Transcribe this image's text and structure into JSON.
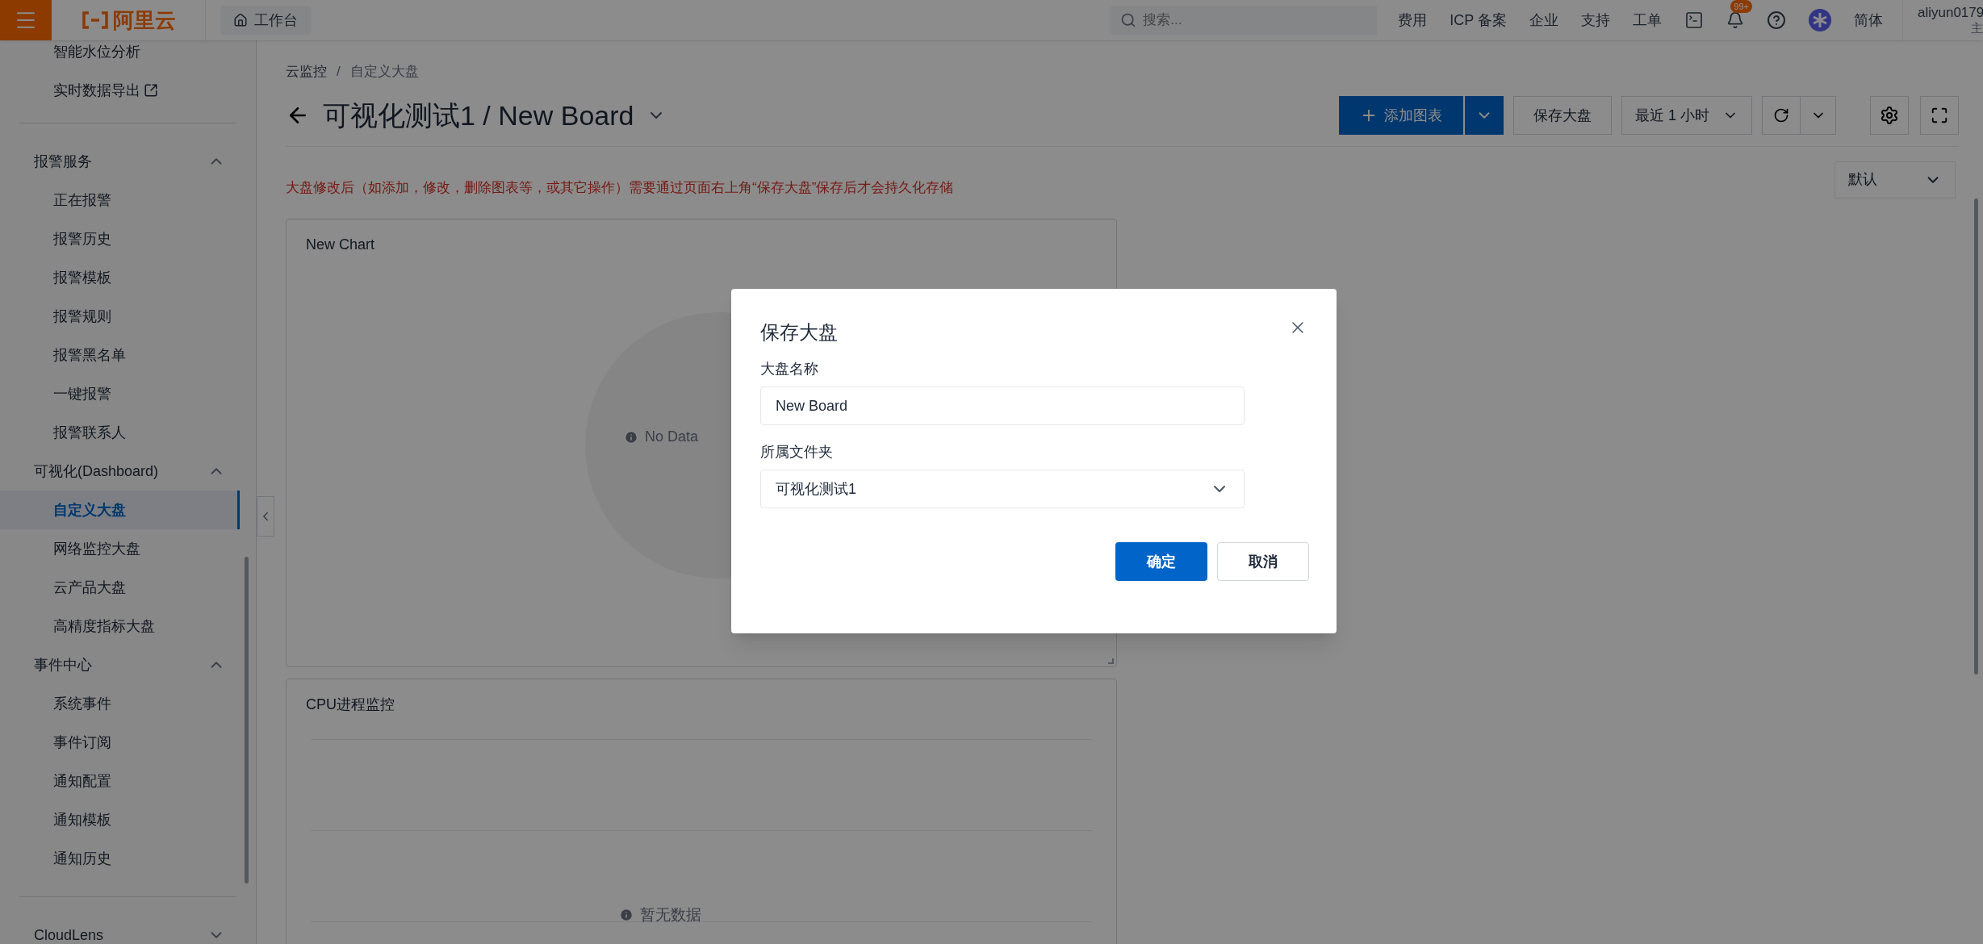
{
  "top_bar": {
    "logo": "阿里云",
    "home_tab": "工作台",
    "search": {
      "placeholder": "搜索..."
    },
    "links": [
      "费用",
      "ICP 备案",
      "企业",
      "支持",
      "工单"
    ],
    "notification_badge": "99+",
    "language": "简体",
    "user": {
      "name": "aliyun0179",
      "role": "主"
    }
  },
  "sidebar": {
    "top_items": [
      {
        "label": "智能水位分析",
        "external": false
      },
      {
        "label": "实时数据导出",
        "external": true
      }
    ],
    "groups": [
      {
        "label": "报警服务",
        "expanded": true,
        "children": [
          {
            "label": "正在报警",
            "selected": false
          },
          {
            "label": "报警历史",
            "selected": false
          },
          {
            "label": "报警模板",
            "selected": false
          },
          {
            "label": "报警规则",
            "selected": false
          },
          {
            "label": "报警黑名单",
            "selected": false
          },
          {
            "label": "一键报警",
            "selected": false
          },
          {
            "label": "报警联系人",
            "selected": false
          }
        ]
      },
      {
        "label": "可视化(Dashboard)",
        "expanded": true,
        "children": [
          {
            "label": "自定义大盘",
            "selected": true
          },
          {
            "label": "网络监控大盘",
            "selected": false
          },
          {
            "label": "云产品大盘",
            "selected": false
          },
          {
            "label": "高精度指标大盘",
            "selected": false
          }
        ]
      },
      {
        "label": "事件中心",
        "expanded": true,
        "children": [
          {
            "label": "系统事件",
            "selected": false
          },
          {
            "label": "事件订阅",
            "selected": false
          },
          {
            "label": "通知配置",
            "selected": false
          },
          {
            "label": "通知模板",
            "selected": false
          },
          {
            "label": "通知历史",
            "selected": false
          }
        ]
      },
      {
        "label": "CloudLens",
        "expanded": false
      }
    ]
  },
  "content": {
    "breadcrumb": {
      "items": [
        "云监控",
        "自定义大盘"
      ],
      "separator": "/"
    },
    "title": "可视化测试1 / New Board",
    "toolbar": {
      "add_chart": "添加图表",
      "save": "保存大盘",
      "time_range": "最近 1 小时"
    },
    "view_select": "默认",
    "notice": "大盘修改后（如添加，修改，删除图表等，或其它操作）需要通过页面右上角“保存大盘”保存后才会持久化存储",
    "charts": [
      {
        "title": "New Chart",
        "kind": "pie",
        "empty_text": "No Data"
      },
      {
        "title": "CPU进程监控",
        "kind": "line",
        "empty_text": "暂无数据"
      }
    ]
  },
  "dialog": {
    "title": "保存大盘",
    "fields": [
      {
        "label": "大盘名称",
        "kind": "text",
        "value": "New Board"
      },
      {
        "label": "所属文件夹",
        "kind": "select",
        "value": "可视化测试1"
      }
    ],
    "buttons": [
      {
        "label": "确定",
        "primary": true
      },
      {
        "label": "取消",
        "primary": false
      }
    ]
  }
}
